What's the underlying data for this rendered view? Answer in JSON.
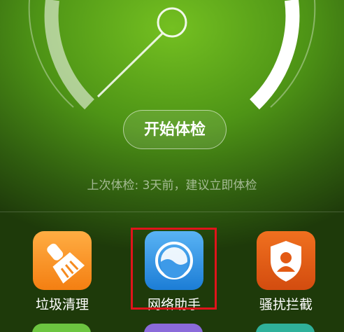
{
  "main": {
    "start_check_label": "开始体检",
    "last_check_text": "上次体检: 3天前，建议立即体检"
  },
  "tools": [
    {
      "label": "垃圾清理",
      "icon": "broom-icon",
      "color": "#f58a1e"
    },
    {
      "label": "网络助手",
      "icon": "network-globe-icon",
      "color": "#2a8de0"
    },
    {
      "label": "骚扰拦截",
      "icon": "shield-person-icon",
      "color": "#e35a14"
    }
  ],
  "colors": {
    "background": "#4e9416",
    "highlight_box": "#e0141b"
  }
}
